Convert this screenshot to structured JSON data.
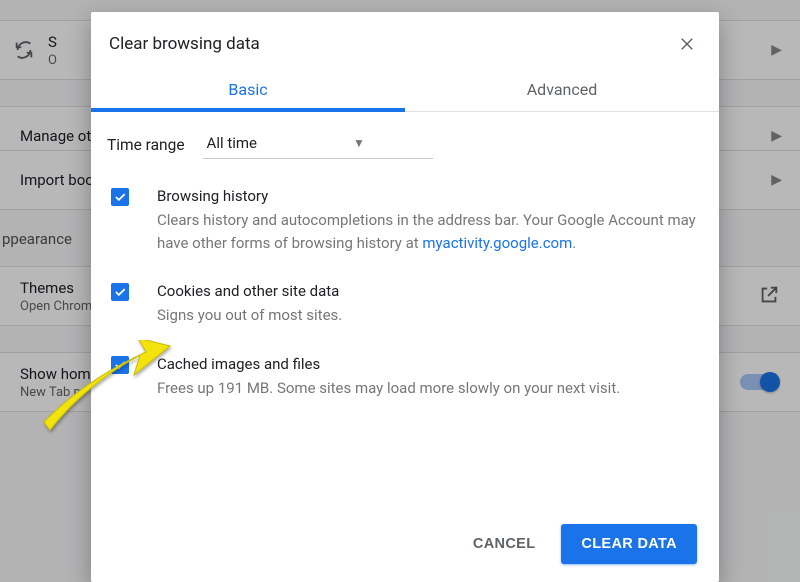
{
  "background": {
    "sync_row_letter": "S",
    "sync_row_sub": "O",
    "manage_row": "Manage ot",
    "import_row": "Import boo",
    "section_appearance": "ppearance",
    "themes_label": "Themes",
    "themes_sub": "Open Chrom",
    "home_label": "Show home",
    "home_sub": "New Tab p"
  },
  "dialog": {
    "title": "Clear browsing data",
    "tabs": {
      "basic": "Basic",
      "advanced": "Advanced"
    },
    "time_label": "Time range",
    "time_value": "All time",
    "items": [
      {
        "title": "Browsing history",
        "desc_pre": "Clears history and autocompletions in the address bar. Your Google Account may have other forms of browsing history at ",
        "link": "myactivity.google.com",
        "desc_post": "."
      },
      {
        "title": "Cookies and other site data",
        "desc_pre": "Signs you out of most sites.",
        "link": "",
        "desc_post": ""
      },
      {
        "title": "Cached images and files",
        "desc_pre": "Frees up 191 MB. Some sites may load more slowly on your next visit.",
        "link": "",
        "desc_post": ""
      }
    ],
    "cancel": "CANCEL",
    "confirm": "CLEAR DATA"
  }
}
